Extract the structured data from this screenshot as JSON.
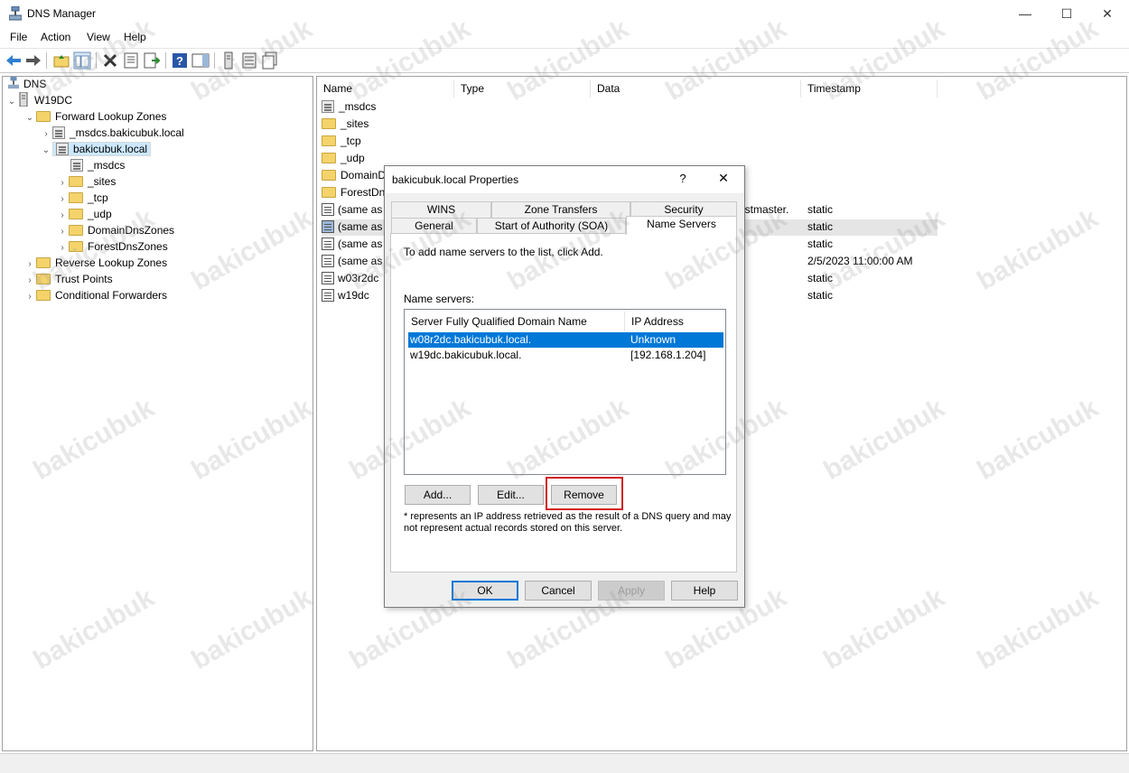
{
  "window": {
    "title": "DNS Manager",
    "minimize": "—",
    "maximize": "☐",
    "close": "✕"
  },
  "menu": [
    "File",
    "Action",
    "View",
    "Help"
  ],
  "tree": {
    "root": "DNS",
    "server": "W19DC",
    "forward": "Forward Lookup Zones",
    "msdcs_zone": "_msdcs.bakicubuk.local",
    "zone": "bakicubuk.local",
    "zone_children": [
      "_msdcs",
      "_sites",
      "_tcp",
      "_udp",
      "DomainDnsZones",
      "ForestDnsZones"
    ],
    "reverse": "Reverse Lookup Zones",
    "trust": "Trust Points",
    "conditional": "Conditional Forwarders"
  },
  "list": {
    "columns": [
      "Name",
      "Type",
      "Data",
      "Timestamp"
    ],
    "rows": [
      {
        "name": "_msdcs",
        "data": "",
        "ts": ""
      },
      {
        "name": "_sites",
        "data": "",
        "ts": ""
      },
      {
        "name": "_tcp",
        "data": "",
        "ts": ""
      },
      {
        "name": "_udp",
        "data": "",
        "ts": ""
      },
      {
        "name": "DomainD",
        "data": "",
        "ts": ""
      },
      {
        "name": "ForestDns",
        "data": "",
        "ts": ""
      },
      {
        "name": "(same as p",
        "data": "ostmaster.",
        "ts": "static"
      },
      {
        "name": "(same as p",
        "data": "",
        "ts": "static"
      },
      {
        "name": "(same as p",
        "data": "",
        "ts": "static"
      },
      {
        "name": "(same as p",
        "data": "",
        "ts": "2/5/2023 11:00:00 AM"
      },
      {
        "name": "w03r2dc",
        "data": "",
        "ts": "static"
      },
      {
        "name": "w19dc",
        "data": "",
        "ts": "static"
      }
    ]
  },
  "dialog": {
    "title": "bakicubuk.local Properties",
    "help": "?",
    "close": "✕",
    "tabs_top": [
      "WINS",
      "Zone Transfers",
      "Security"
    ],
    "tabs_bottom": [
      "General",
      "Start of Authority (SOA)",
      "Name Servers"
    ],
    "instruction": "To add name servers to the list, click Add.",
    "list_label": "Name servers:",
    "list_columns": [
      "Server Fully Qualified Domain Name (FQDN)",
      "IP Address"
    ],
    "servers": [
      {
        "fqdn": "w08r2dc.bakicubuk.local.",
        "ip": "Unknown"
      },
      {
        "fqdn": "w19dc.bakicubuk.local.",
        "ip": "[192.168.1.204]"
      }
    ],
    "add": "Add...",
    "edit": "Edit...",
    "remove": "Remove",
    "note_line1": "* represents an IP address retrieved as the result of a DNS query and may",
    "note_line2": "not represent actual records stored on this server.",
    "ok": "OK",
    "cancel": "Cancel",
    "apply": "Apply",
    "help_btn": "Help"
  },
  "watermark": "bakicubuk"
}
